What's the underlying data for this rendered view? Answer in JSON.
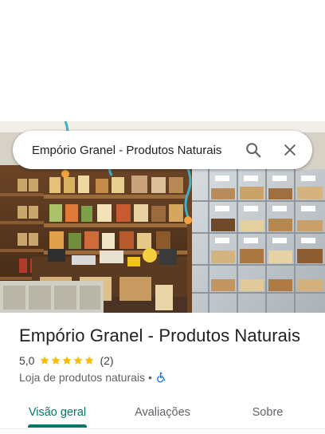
{
  "search": {
    "query": "Empório Granel - Produtos Naturais"
  },
  "icons": {
    "search": "search-icon",
    "close": "close-icon",
    "star": "star-icon",
    "accessibility": "wheelchair-icon"
  },
  "place": {
    "name": "Empório Granel - Produtos Naturais",
    "rating": "5,0",
    "stars": 5,
    "review_count": "(2)",
    "category": "Loja de produtos naturais",
    "separator": "•"
  },
  "tabs": [
    {
      "label": "Visão geral",
      "active": true
    },
    {
      "label": "Avaliações",
      "active": false
    },
    {
      "label": "Sobre",
      "active": false
    }
  ],
  "colors": {
    "accent": "#00796b",
    "star": "#fbbc04",
    "accessibility": "#1a73e8"
  }
}
